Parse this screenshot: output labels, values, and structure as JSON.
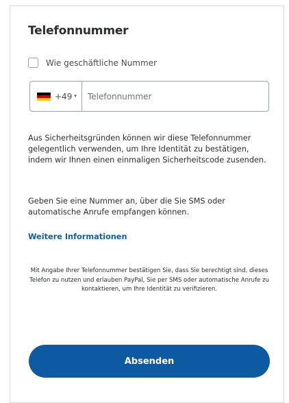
{
  "form": {
    "title": "Telefonnummer",
    "business_checkbox_label": "Wie geschäftliche Nummer",
    "business_checkbox_checked": false,
    "country": {
      "flag": "germany-flag-icon",
      "flag_colors": [
        "#000000",
        "#dd0000",
        "#ffce00"
      ],
      "code": "+49",
      "caret": "▾"
    },
    "phone_placeholder": "Telefonnummer",
    "phone_value": "",
    "info_paragraph_1": "Aus Sicherheitsgründen können wir diese Telefonnummer gelegentlich verwenden, um Ihre Identität zu bestätigen, indem wir Ihnen einen einmaligen Sicherheitscode zusenden.",
    "info_paragraph_2": "Geben Sie eine Nummer an, über die Sie SMS oder automatische Anrufe empfangen können.",
    "more_info_link": "Weitere Informationen",
    "legal_text": "Mit Angabe Ihrer Telefonnummer bestätigen Sie, dass Sie berechtigt sind, dieses Telefon zu nutzen und erlauben PayPal, Sie per SMS oder automatische Anrufe zu kontaktieren, um Ihre Identität zu verifizieren.",
    "submit_label": "Absenden"
  },
  "colors": {
    "primary_button": "#0d5aa3",
    "link": "#0c5fa8",
    "border": "#9da3a6"
  }
}
